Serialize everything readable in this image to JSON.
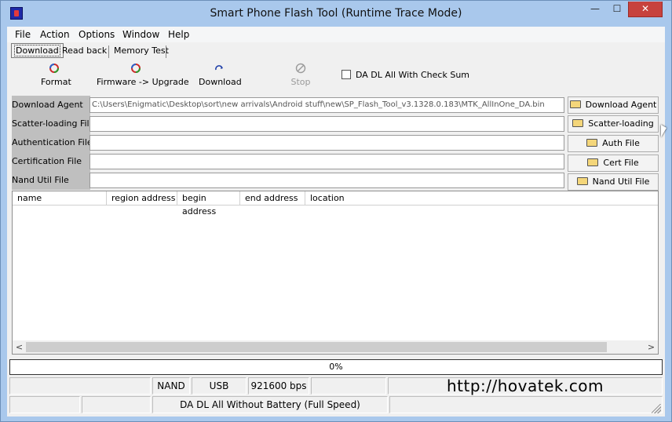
{
  "window": {
    "title": "Smart Phone Flash Tool (Runtime Trace Mode)",
    "minimize_glyph": "—",
    "maximize_glyph": "☐",
    "close_glyph": "✕"
  },
  "menu": [
    "File",
    "Action",
    "Options",
    "Window",
    "Help"
  ],
  "tabs": [
    "Download",
    "Read back",
    "Memory Test"
  ],
  "toolbar": {
    "format": "Format",
    "firmware_upgrade": "Firmware -> Upgrade",
    "download": "Download",
    "stop": "Stop",
    "checksum_label": "DA DL All With Check Sum"
  },
  "files": {
    "download_agent": {
      "label": "Download Agent",
      "value": "C:\\Users\\Enigmatic\\Desktop\\sort\\new arrivals\\Android stuff\\new\\SP_Flash_Tool_v3.1328.0.183\\MTK_AllInOne_DA.bin",
      "button": "Download Agent"
    },
    "scatter": {
      "label": "Scatter-loading File",
      "value": "",
      "button": "Scatter-loading"
    },
    "auth": {
      "label": "Authentication File",
      "value": "",
      "button": "Auth File"
    },
    "cert": {
      "label": "Certification File",
      "value": "",
      "button": "Cert File"
    },
    "nand": {
      "label": "Nand Util File",
      "value": "",
      "button": "Nand Util File"
    }
  },
  "table": {
    "columns": [
      "name",
      "region address",
      "begin address",
      "end address",
      "location"
    ],
    "rows": []
  },
  "progress": {
    "text": "0%",
    "value": 0
  },
  "status": {
    "storage": "NAND",
    "port": "USB",
    "baud": "921600 bps",
    "url": "http://hovatek.com",
    "mode": "DA DL All Without Battery (Full Speed)"
  },
  "colors": {
    "close_button": "#c7423d",
    "label_bg": "#c0c0c0",
    "progress_fill": "#3b8d3b"
  }
}
